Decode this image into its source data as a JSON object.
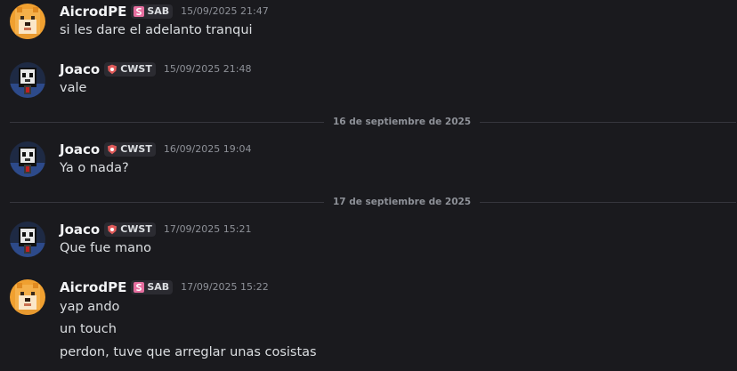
{
  "users": {
    "aicrod": {
      "name": "AicrodPE",
      "tag": "SAB",
      "tag_icon": "s-logo-icon",
      "tag_color": "#e66fa0",
      "avatar": "shiba-dog-avatar"
    },
    "joaco": {
      "name": "Joaco",
      "tag": "CWST",
      "tag_icon": "shield-icon",
      "tag_color": "#e05a5a",
      "avatar": "pixel-creature-avatar"
    }
  },
  "messages": [
    {
      "author": "AicrodPE",
      "tag": "SAB",
      "time": "15/09/2025 21:47",
      "lines": [
        "si les dare el adelanto tranqui"
      ]
    },
    {
      "author": "Joaco",
      "tag": "CWST",
      "time": "15/09/2025 21:48",
      "lines": [
        "vale"
      ]
    },
    {
      "author": "Joaco",
      "tag": "CWST",
      "time": "16/09/2025 19:04",
      "lines": [
        "Ya o nada?"
      ]
    },
    {
      "author": "Joaco",
      "tag": "CWST",
      "time": "17/09/2025 15:21",
      "lines": [
        "Que fue mano"
      ]
    },
    {
      "author": "AicrodPE",
      "tag": "SAB",
      "time": "17/09/2025 15:22",
      "lines": [
        "yap ando",
        "un touch",
        "perdon, tuve que arreglar unas cosistas"
      ]
    }
  ],
  "dividers": [
    "16 de septiembre de 2025",
    "17 de septiembre de 2025"
  ],
  "colors": {
    "background": "#1a1a1e",
    "username": "#f2f3f5",
    "message_text": "#dbdee1",
    "timestamp": "#8e9198",
    "divider": "#36363d"
  }
}
